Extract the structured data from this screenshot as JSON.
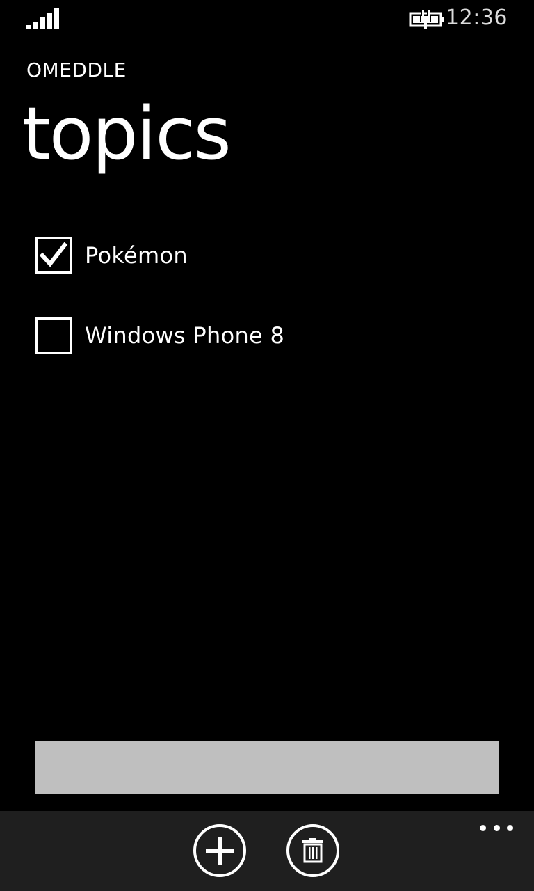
{
  "status_bar": {
    "time": "12:36",
    "signal_icon": "signal-strength-icon",
    "battery_icon": "battery-charging-icon"
  },
  "header": {
    "app_title": "OMEDDLE",
    "page_title": "topics"
  },
  "topics": [
    {
      "label": "Pokémon",
      "checked": true
    },
    {
      "label": "Windows Phone 8",
      "checked": false
    }
  ],
  "input": {
    "value": "",
    "background": "#bfbfbf"
  },
  "app_bar": {
    "buttons": [
      {
        "icon": "add-icon"
      },
      {
        "icon": "delete-icon"
      }
    ],
    "more_icon": "ellipsis-icon"
  },
  "colors": {
    "background": "#000000",
    "foreground": "#ffffff",
    "app_bar": "#1f1f1f"
  }
}
